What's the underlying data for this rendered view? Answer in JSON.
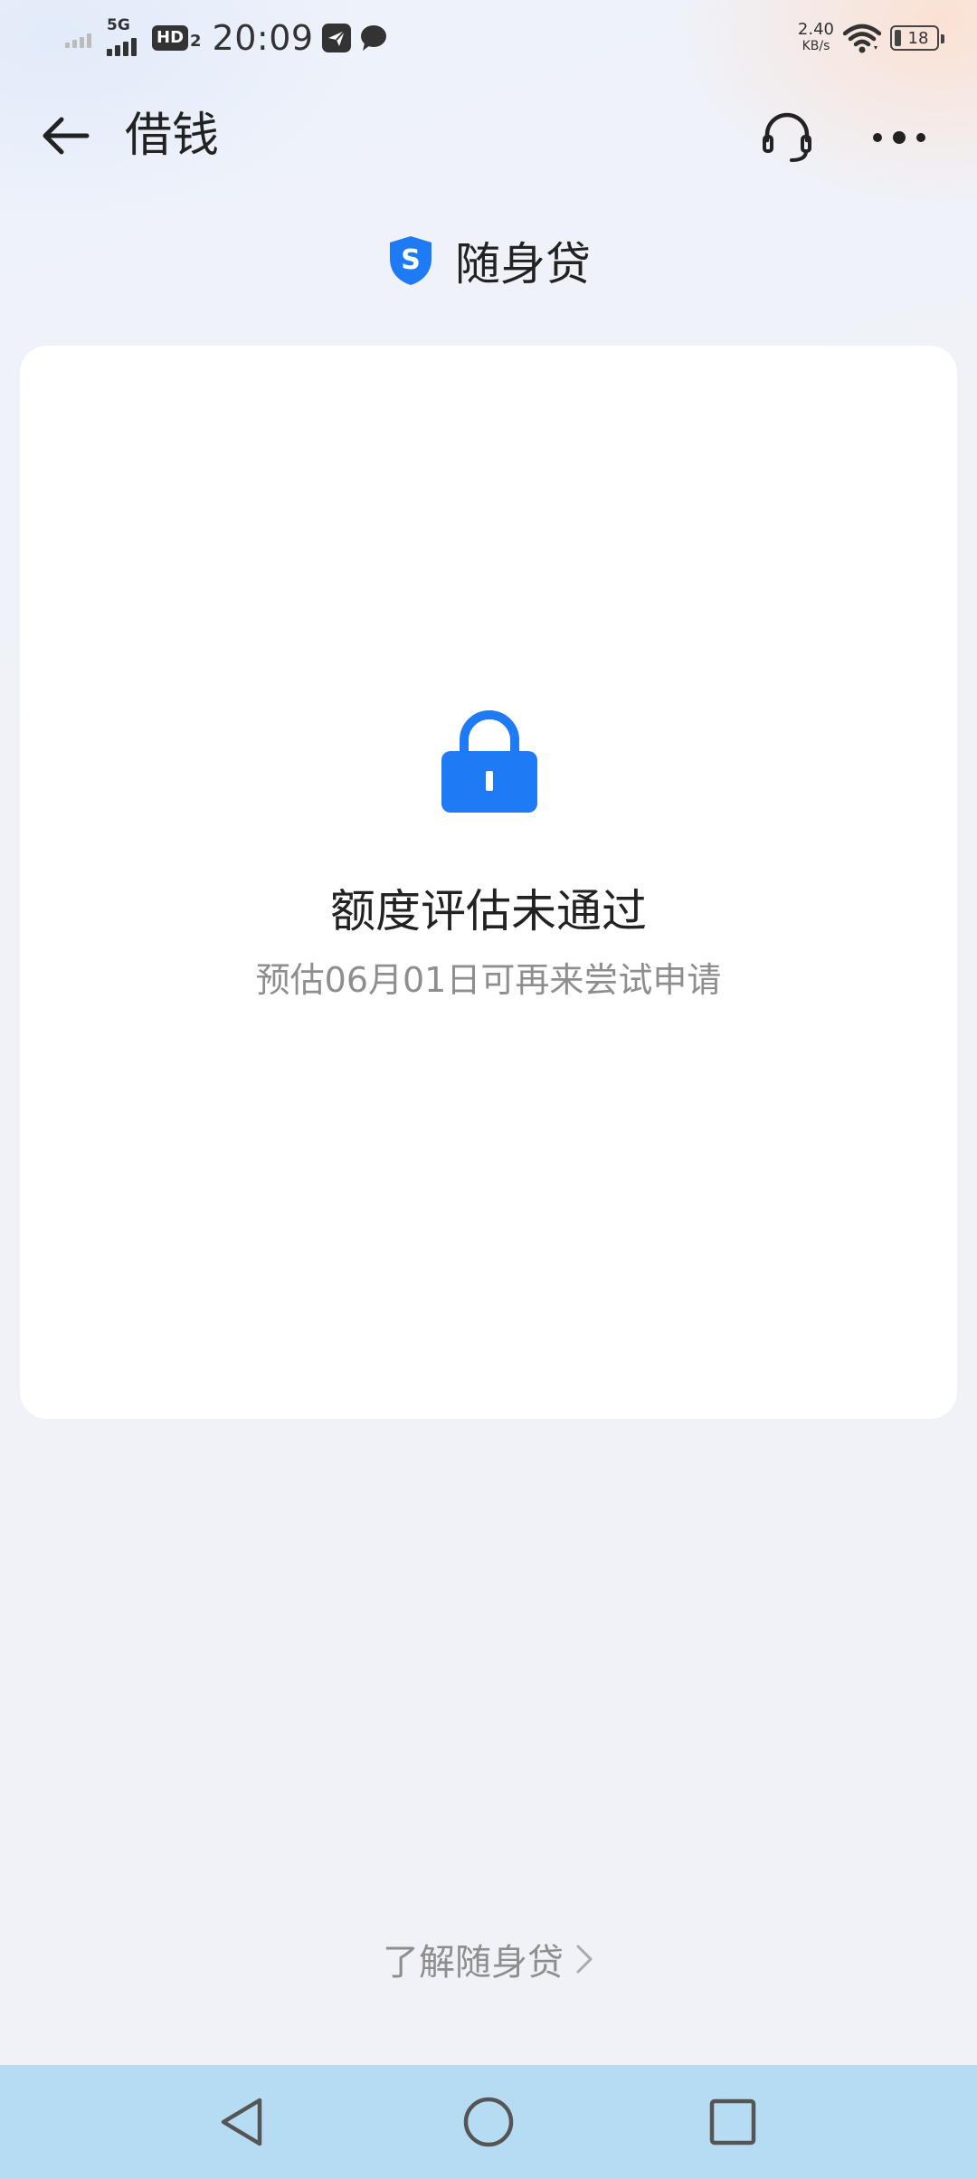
{
  "status_bar": {
    "network_type": "5G",
    "hd_label": "HD",
    "hd_sub": "2",
    "time": "20:09",
    "net_speed_value": "2.40",
    "net_speed_unit": "KB/s",
    "battery_level": "18"
  },
  "header": {
    "title": "借钱"
  },
  "product": {
    "logo_letter": "S",
    "name": "随身贷"
  },
  "result": {
    "title": "额度评估未通过",
    "subtitle": "预估06月01日可再来尝试申请"
  },
  "footer": {
    "learn_more": "了解随身贷"
  },
  "colors": {
    "brand_blue": "#1f7bf5",
    "nav_bar": "#b6dcf3"
  }
}
